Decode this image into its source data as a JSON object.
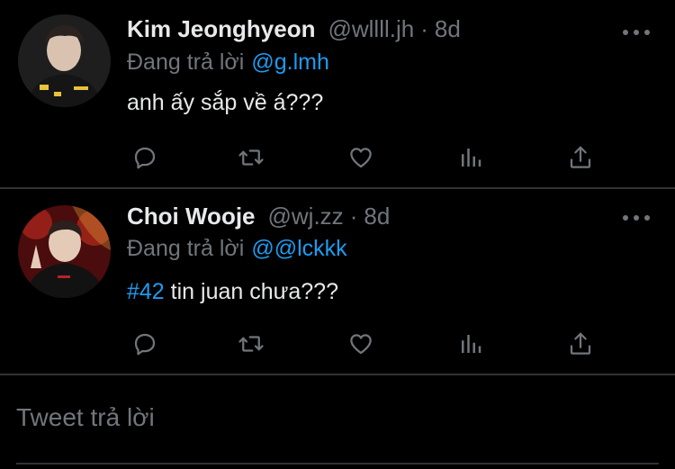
{
  "tweets": [
    {
      "display_name": "Kim Jeonghyeon",
      "handle": "@wllll.jh",
      "separator": "·",
      "time": "8d",
      "reply_prefix": "Đang trả lời",
      "reply_target": "@g.lmh",
      "hashtag": "",
      "text": "anh ấy sắp về á???",
      "avatar_icon": "avatar-photo"
    },
    {
      "display_name": "Choi Wooje",
      "handle": "@wj.zz",
      "separator": "·",
      "time": "8d",
      "reply_prefix": "Đang trả lời",
      "reply_target": "@@lckkk",
      "hashtag": "#42",
      "text": " tin juan chưa???",
      "avatar_icon": "avatar-photo"
    }
  ],
  "actions": [
    "reply-icon",
    "retweet-icon",
    "like-icon",
    "stats-icon",
    "share-icon"
  ],
  "reply_box": {
    "placeholder": "Tweet trả lời"
  },
  "colors": {
    "background": "#000000",
    "text": "#e7e9ea",
    "muted": "#71767b",
    "accent": "#1d9bf0",
    "divider": "#2f3336"
  }
}
